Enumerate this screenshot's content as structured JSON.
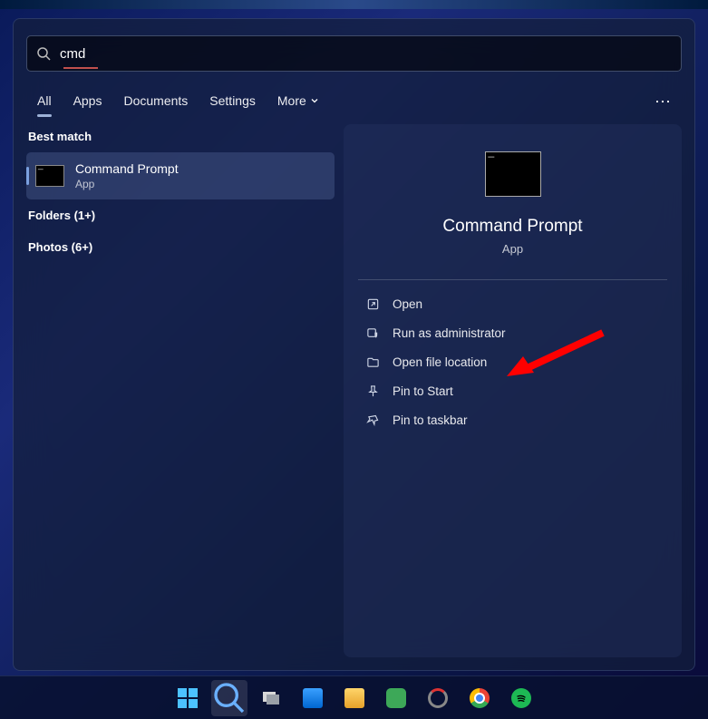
{
  "search": {
    "value": "cmd"
  },
  "tabs": {
    "all": "All",
    "apps": "Apps",
    "documents": "Documents",
    "settings": "Settings",
    "more": "More"
  },
  "left": {
    "best_match": "Best match",
    "result": {
      "title": "Command Prompt",
      "subtitle": "App"
    },
    "folders": "Folders (1+)",
    "photos": "Photos (6+)"
  },
  "preview": {
    "title": "Command Prompt",
    "subtitle": "App",
    "actions": {
      "open": "Open",
      "run_admin": "Run as administrator",
      "open_loc": "Open file location",
      "pin_start": "Pin to Start",
      "pin_taskbar": "Pin to taskbar"
    }
  }
}
